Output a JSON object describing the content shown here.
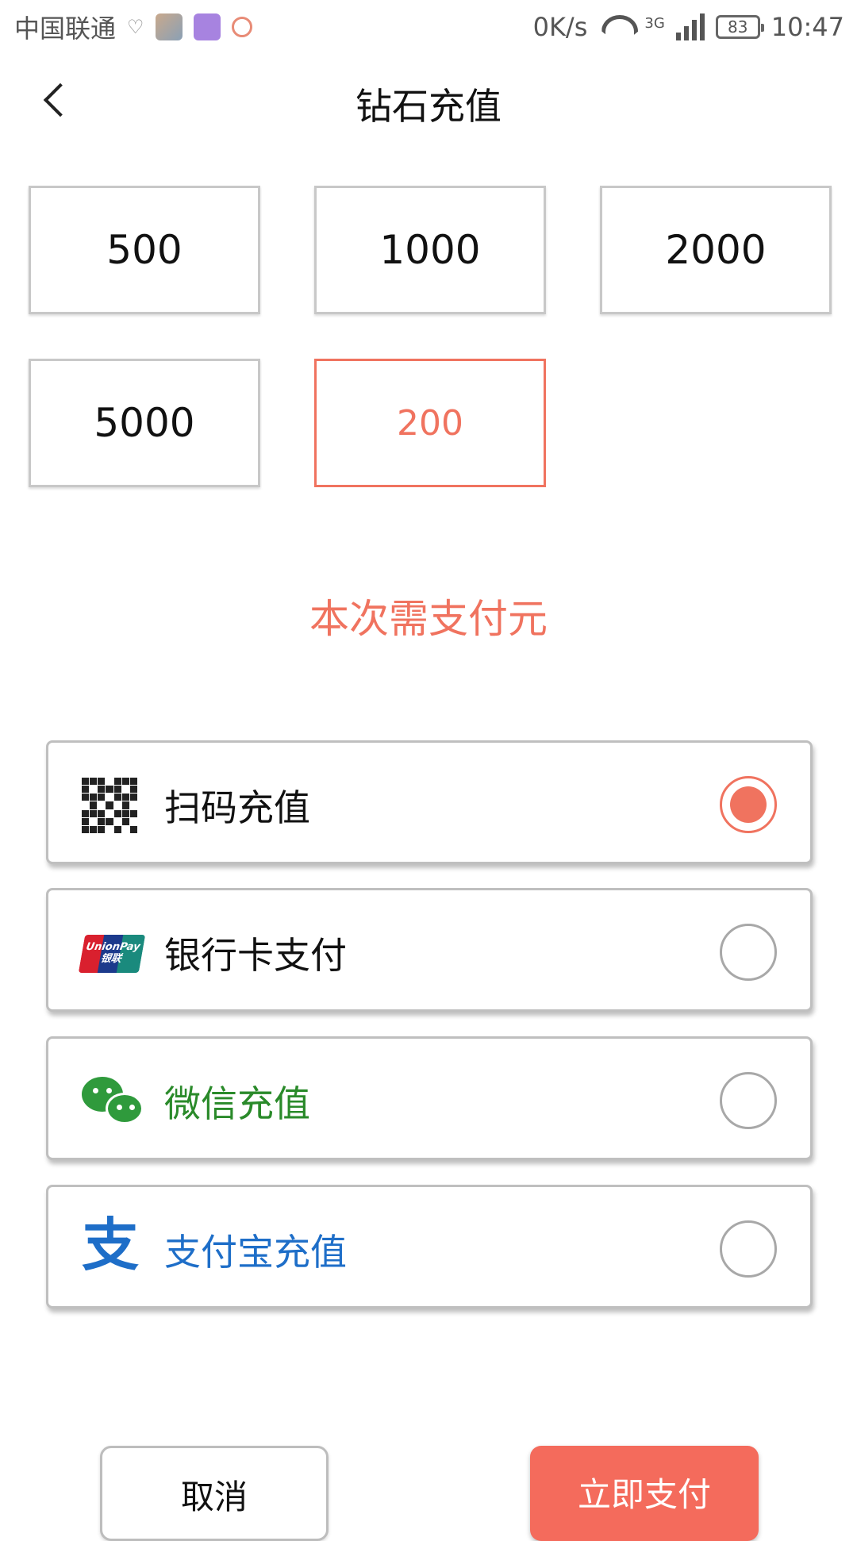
{
  "status_bar": {
    "carrier": "中国联通",
    "net_speed": "0K/s",
    "network_type": "3G",
    "battery": "83",
    "time": "10:47"
  },
  "header": {
    "title": "钻石充值"
  },
  "amounts": {
    "options": [
      "500",
      "1000",
      "2000",
      "5000"
    ],
    "custom_value": "200"
  },
  "payment_summary": "本次需支付元",
  "payment_methods": [
    {
      "label": "扫码充值",
      "icon": "qr-code-icon",
      "color": "#111111",
      "selected": true
    },
    {
      "label": "银行卡支付",
      "icon": "unionpay-icon",
      "color": "#111111",
      "selected": false
    },
    {
      "label": "微信充值",
      "icon": "wechat-icon",
      "color": "#2a8a2a",
      "selected": false
    },
    {
      "label": "支付宝充值",
      "icon": "alipay-icon",
      "color": "#1e6ec8",
      "selected": false
    }
  ],
  "icons": {
    "unionpay_text_top": "UnionPay",
    "unionpay_text_bottom": "银联",
    "alipay_glyph": "支"
  },
  "actions": {
    "cancel_label": "取消",
    "pay_label": "立即支付"
  },
  "colors": {
    "accent": "#f0735f",
    "pay_button": "#f46b5c"
  }
}
